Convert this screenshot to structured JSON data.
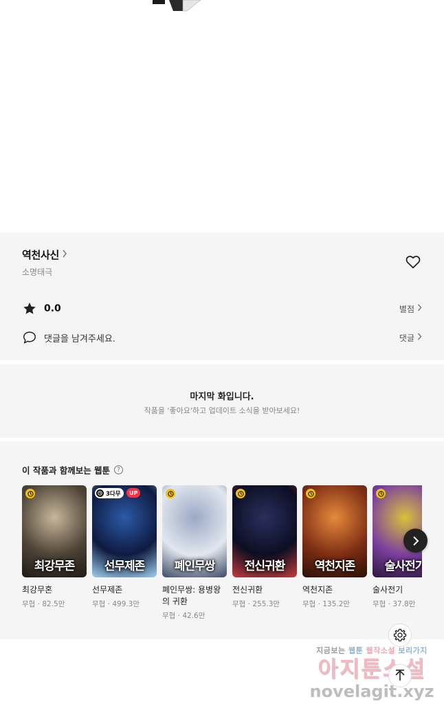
{
  "work": {
    "title": "역천사신",
    "author": "소명태극",
    "rating": "0.0",
    "rating_link": "별점",
    "comment_prompt": "댓글을 남겨주세요.",
    "comment_link": "댓글"
  },
  "end_notice": {
    "title": "마지막 화입니다.",
    "subtitle": "작품을 '좋아요'하고 업데이트 소식을 받아보세요!"
  },
  "recommendations": {
    "heading": "이 작품과 함께보는 웹툰",
    "help_icon": "?",
    "items": [
      {
        "art_text": "최강무존",
        "name": "최강무혼",
        "meta": "무협 · 82.5만",
        "badge": "clock",
        "colors": [
          "#c9b79b",
          "#4e4437",
          "#1e1a16"
        ]
      },
      {
        "art_text": "선무제존",
        "name": "선무제존",
        "meta": "무협 · 499.3만",
        "badge": "wait",
        "wait_label": "3다무",
        "up_label": "UP",
        "colors": [
          "#2c5aa8",
          "#0e1a3f",
          "#9fd0f0"
        ]
      },
      {
        "art_text": "폐인무쌍",
        "name": "폐인무쌍: 용병왕의 귀환",
        "meta": "무협 · 42.6만",
        "badge": "clock",
        "colors": [
          "#9aa9c4",
          "#e2e7ef",
          "#3b4a66"
        ]
      },
      {
        "art_text": "전신귀환",
        "name": "전신귀환",
        "meta": "무협 · 255.3만",
        "badge": "clock",
        "colors": [
          "#2a2f5c",
          "#0c0e22",
          "#c33b3b"
        ]
      },
      {
        "art_text": "역천지존",
        "name": "역천지존",
        "meta": "무협 · 135.2만",
        "badge": "clock",
        "colors": [
          "#e78a3c",
          "#7e2e14",
          "#2a1008"
        ]
      },
      {
        "art_text": "술사전기",
        "name": "술사전기",
        "meta": "무협 · 37.8만",
        "badge": "clock",
        "colors": [
          "#d8c13b",
          "#7b3f9e",
          "#2d173d"
        ]
      }
    ]
  },
  "watermark": {
    "line1_a": "지금보는",
    "line1_b": "웹툰",
    "line1_c": "웹작소설",
    "line1_d": "보리가지",
    "line2": "아지툰소설",
    "line3": "novelagit.xyz"
  },
  "icons": {
    "heart": "heart-icon",
    "star": "star-icon",
    "comment": "speech-bubble-icon",
    "next": "chevron-right-icon",
    "settings": "gear-icon",
    "scroll_top": "arrow-up-icon"
  }
}
